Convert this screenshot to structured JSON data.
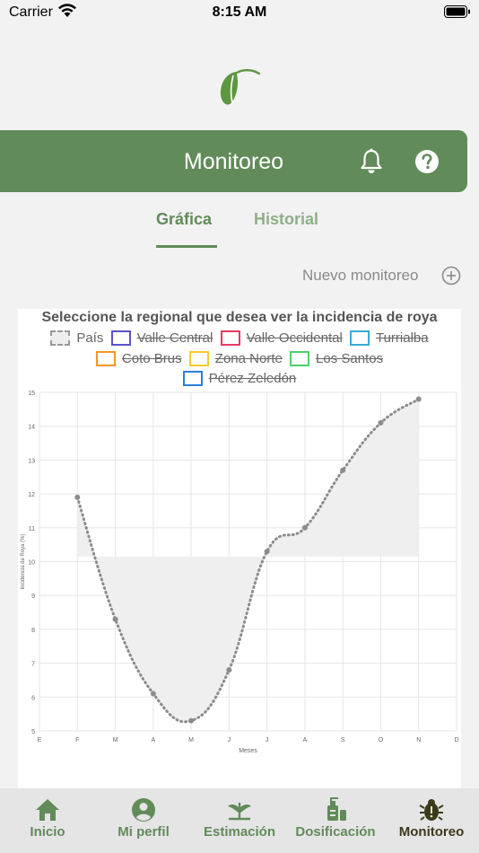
{
  "status_bar": {
    "carrier": "Carrier",
    "time": "8:15 AM"
  },
  "header": {
    "title": "Monitoreo"
  },
  "tabs": [
    {
      "label": "Gráfica",
      "active": true
    },
    {
      "label": "Historial",
      "active": false
    }
  ],
  "new_monitoring": {
    "label": "Nuevo monitoreo"
  },
  "chart": {
    "title": "Seleccione la regional que desea ver la incidencia de roya",
    "legend": [
      {
        "label": "País",
        "color": "#999999",
        "active": true
      },
      {
        "label": "Valle Central",
        "color": "#5b52c8",
        "active": false
      },
      {
        "label": "Valle Occidental",
        "color": "#e83a63",
        "active": false
      },
      {
        "label": "Turrialba",
        "color": "#3aabd6",
        "active": false
      },
      {
        "label": "Coto Brus",
        "color": "#f5981e",
        "active": false
      },
      {
        "label": "Zona Norte",
        "color": "#f5cc2b",
        "active": false
      },
      {
        "label": "Los Santos",
        "color": "#4ed06a",
        "active": false
      },
      {
        "label": "Pérez Zeledón",
        "color": "#2a7fe0",
        "active": false
      }
    ]
  },
  "chart_data": {
    "type": "line",
    "categories": [
      "E",
      "F",
      "M",
      "A",
      "M",
      "J",
      "J",
      "A",
      "S",
      "O",
      "N",
      "D"
    ],
    "series": [
      {
        "name": "País",
        "values": [
          null,
          11.9,
          8.3,
          6.1,
          5.3,
          6.8,
          10.3,
          11.0,
          12.7,
          14.1,
          14.8,
          null
        ]
      }
    ],
    "fill_baseline": 10.15,
    "ylim": [
      5,
      15
    ],
    "yticks": [
      5,
      6,
      7,
      8,
      9,
      10,
      11,
      12,
      13,
      14,
      15
    ],
    "xlabel": "Meses",
    "ylabel": "Incidencia de Roya (%)",
    "grid": true,
    "colors": {
      "line": "#8c8c8c",
      "fill": "#efefef",
      "grid": "#e6e6e6"
    }
  },
  "bottom_nav": [
    {
      "label": "Inicio",
      "icon": "home-icon",
      "active": false
    },
    {
      "label": "Mi perfil",
      "icon": "user-circle-icon",
      "active": false
    },
    {
      "label": "Estimación",
      "icon": "plant-icon",
      "active": false
    },
    {
      "label": "Dosificación",
      "icon": "sprayer-icon",
      "active": false
    },
    {
      "label": "Monitoreo",
      "icon": "bug-icon",
      "active": true
    }
  ],
  "colors": {
    "brand": "#618b59",
    "brand_light": "#8fae88",
    "active_nav": "#3b3a1d"
  }
}
